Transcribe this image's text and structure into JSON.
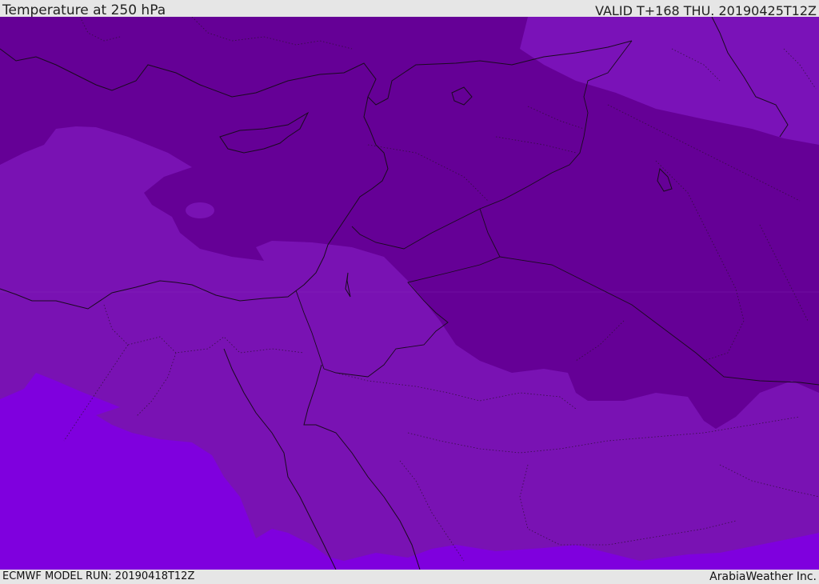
{
  "header": {
    "title": "Temperature at 250 hPa",
    "valid_time": "VALID T+168 THU. 20190425T12Z"
  },
  "footer": {
    "model_run": "ECMWF MODEL RUN: 20190418T12Z",
    "credit": "ArabiaWeather Inc."
  },
  "colors": {
    "dark_band": "#650096",
    "mid_band": "#7912b3",
    "light_band": "#7f00de",
    "upper_right_band": "#7a12b8",
    "coastline": "#1a0a1f"
  }
}
